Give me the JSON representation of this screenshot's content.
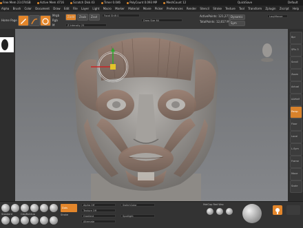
{
  "status_bar": {
    "items": [
      {
        "label": "Free Mem 23.074GB"
      },
      {
        "label": "Active Mem 4716"
      },
      {
        "label": "Scratch Disk 43"
      },
      {
        "label": "Timer 0.046"
      },
      {
        "label": "PolyCount 0.093 MP"
      },
      {
        "label": "MeshCount 12"
      }
    ],
    "right_text": "QuickSave",
    "far_right": "Default"
  },
  "menu": {
    "items": [
      "Alpha",
      "Brush",
      "Color",
      "Document",
      "Draw",
      "Edit",
      "File",
      "Layer",
      "Light",
      "Macro",
      "Marker",
      "Material",
      "Movie",
      "Picker",
      "Preferences",
      "Render",
      "Stencil",
      "Stroke",
      "Texture",
      "Tool",
      "Transform",
      "Zplugin",
      "Zscript",
      "Help"
    ]
  },
  "toolbar": {
    "left_label": "Home Page",
    "modes": {
      "edit": "Edit",
      "draw": "Draw",
      "move": "Move",
      "scale": "Scale",
      "rotate": "Rotate"
    },
    "mrgb": "Mrgb",
    "rgb": "Rgb",
    "m": "M",
    "zadd": "Zadd",
    "zsub": "Zsub",
    "zcut": "Zcut",
    "focal_shift_label": "Focal Shift",
    "focal_shift_value": "0",
    "draw_size_label": "Draw Size",
    "draw_size_value": "64",
    "z_intensity_label": "Z Intensity",
    "z_intensity_value": "25",
    "active_points": "ActivePoints: 121,271",
    "total_points": "TotalPoints: 12,817 Mil",
    "dynamic": "Dynamic",
    "sym": "Sym",
    "lazy_label": "LazyMouse"
  },
  "viewport": {
    "background_top": "#6d6f72",
    "background_bottom": "#85878b",
    "skin_color": "#a8a6a3",
    "muscle_color": "#8a6f62"
  },
  "bottom_bar": {
    "brushes_row1": [
      "Standard",
      "Move",
      "ClayBuildup",
      "Smooth",
      "Inflate",
      "DamStandard",
      "TrimDynamic"
    ],
    "brushes_row2": [
      "hPolish",
      "Pinch",
      "ClayTubes",
      "Dam",
      "Flatten",
      "SnakeHook",
      "Slash"
    ],
    "stroke_label": "Stroke",
    "stroke_value": "Dots",
    "alpha_label": "Alpha Off",
    "mat_label": "MatCap Red Wax",
    "texture_label": "Texture Off",
    "gradient_label": "Gradient",
    "switch_label": "SwitchColor",
    "alternate_label": "Alternate",
    "spot_label": "Spotlight",
    "accent_color": "#e3862b"
  },
  "right_panel": {
    "buttons": [
      "Bpr",
      "SPix 3",
      "Scroll",
      "Zoom",
      "Actual",
      "AAHalf",
      "Persp",
      "Floor",
      "Local",
      "L.Sym",
      "Frame",
      "Move",
      "Scale",
      "Rotate",
      "PolyF",
      "Transp"
    ]
  }
}
